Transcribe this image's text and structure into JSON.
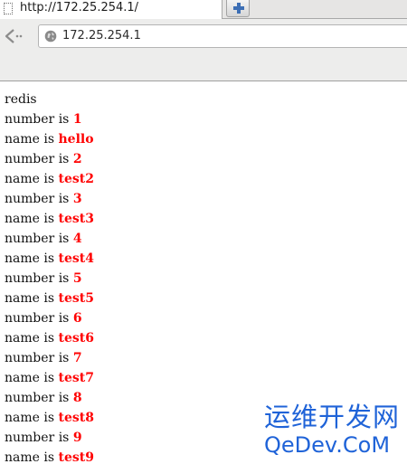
{
  "browser": {
    "tab": {
      "title": "http://172.25.254.1/"
    },
    "url": "172.25.254.1"
  },
  "page": {
    "heading": "redis",
    "records": [
      {
        "number_label": "number is",
        "number": "1",
        "name_label": "name is",
        "name": "hello"
      },
      {
        "number_label": "number is",
        "number": "2",
        "name_label": "name is",
        "name": "test2"
      },
      {
        "number_label": "number is",
        "number": "3",
        "name_label": "name is",
        "name": "test3"
      },
      {
        "number_label": "number is",
        "number": "4",
        "name_label": "name is",
        "name": "test4"
      },
      {
        "number_label": "number is",
        "number": "5",
        "name_label": "name is",
        "name": "test5"
      },
      {
        "number_label": "number is",
        "number": "6",
        "name_label": "name is",
        "name": "test6"
      },
      {
        "number_label": "number is",
        "number": "7",
        "name_label": "name is",
        "name": "test7"
      },
      {
        "number_label": "number is",
        "number": "8",
        "name_label": "name is",
        "name": "test8"
      },
      {
        "number_label": "number is",
        "number": "9",
        "name_label": "name is",
        "name": "test9"
      }
    ]
  },
  "watermark": {
    "chinese": "运维开发网",
    "english": "QeDev.CoM"
  },
  "colors": {
    "value_highlight": "#ff0000",
    "watermark": "#1f63d8"
  }
}
